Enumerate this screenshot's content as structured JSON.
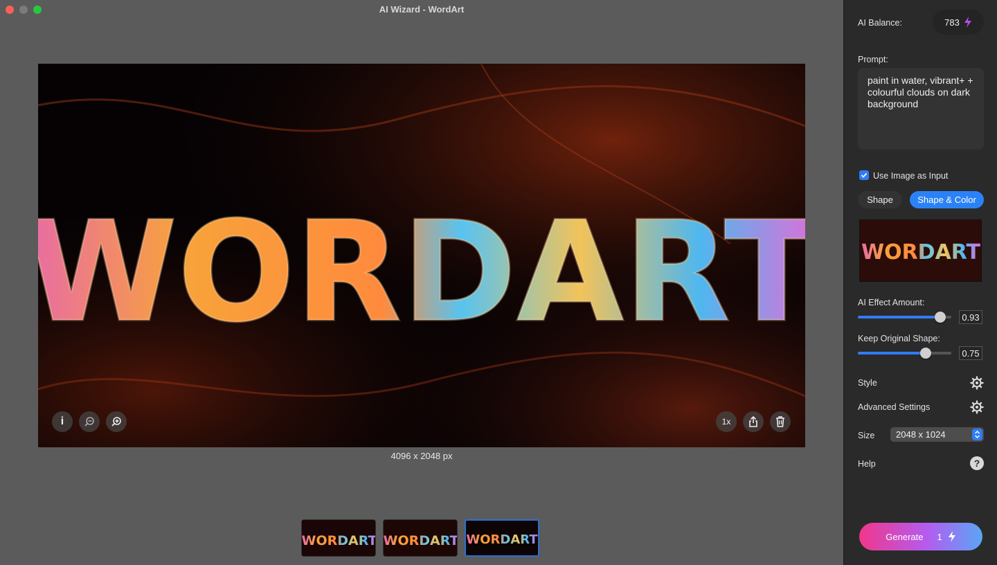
{
  "window": {
    "title": "AI Wizard - WordArt"
  },
  "canvas": {
    "artwork_text": "WORDART",
    "image_size": "4096 x 2048 px",
    "zoom_label": "1x",
    "icons": {
      "info": "info-icon",
      "zoom_out": "zoom-out-icon",
      "zoom_in": "zoom-in-icon",
      "share": "share-icon",
      "delete": "trash-icon"
    }
  },
  "history": {
    "thumbnails": [
      {
        "text": "WORDART",
        "selected": false
      },
      {
        "text": "WORDART",
        "selected": false
      },
      {
        "text": "WORDART",
        "selected": true
      }
    ]
  },
  "sidebar": {
    "balance_label": "AI Balance:",
    "balance_value": "783",
    "prompt_label": "Prompt:",
    "prompt_text": "paint in water, vibrant+ + colourful clouds on dark background",
    "use_image_label": "Use Image as Input",
    "use_image_checked": true,
    "mode_options": [
      "Shape",
      "Shape & Color"
    ],
    "mode_selected": "Shape & Color",
    "effect_label": "AI Effect Amount:",
    "effect_value": "0.93",
    "keep_shape_label": "Keep Original Shape:",
    "keep_shape_value": "0.75",
    "style_label": "Style",
    "advanced_label": "Advanced Settings",
    "size_label": "Size",
    "size_value": "2048 x 1024",
    "help_label": "Help",
    "generate_label": "Generate",
    "generate_cost": "1"
  },
  "colors": {
    "accent": "#2f7cf6",
    "gradient_start": "#f0378a",
    "gradient_end": "#5aa6f5",
    "background": "#5b5b5b",
    "sidebar": "#2a2a2a"
  }
}
